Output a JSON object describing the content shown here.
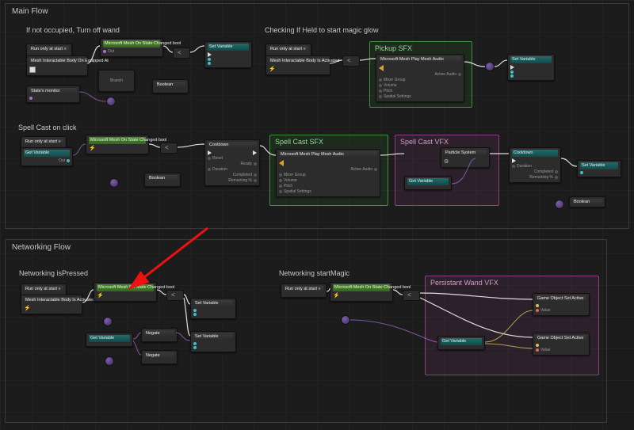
{
  "sections": {
    "main": {
      "label": "Main Flow"
    },
    "net": {
      "label": "Networking Flow"
    }
  },
  "comments": {
    "c1": "If not occupied, Turn off wand",
    "c2": "Checking If Held to start magic glow",
    "c3": "Spell Cast on click",
    "c4": "Networking isPressed",
    "c5": "Networking startMagic"
  },
  "groups": {
    "pickup_sfx": {
      "title": "Pickup SFX"
    },
    "cast_sfx": {
      "title": "Spell Cast SFX"
    },
    "cast_vfx": {
      "title": "Spell Cast VFX"
    },
    "persist_vfx": {
      "title": "Persistant Wand VFX"
    }
  },
  "node_labels": {
    "run_every": "Run only at start »",
    "on_state_change": "Microsoft Mesh\nOn State Changed\nbool",
    "on_equipped": "Mesh Interactable Body\nOn Equipped At",
    "state_monitor": "State's monitor",
    "set_variable": "Set Variable",
    "get_variable": "Get Variable",
    "branch": "Branch",
    "boolean": "Boolean",
    "play_audio": "Microsoft Mesh\nPlay Mesh Audio",
    "cooldown": "Cooldown",
    "particle_sys": "Particle System",
    "is_activated": "Mesh Interactable Body\nIs Activated",
    "negate": "Negate",
    "set_active": "Game Object\nSet Active",
    "pins": {
      "out": "Out",
      "value": "Value",
      "ready": "Ready",
      "completed": "Completed",
      "remaining": "Remaining %",
      "duration": "Duration",
      "mixer_group": "Mixer Group",
      "volume": "Volume",
      "pitch": "Pitch",
      "spatial": "Spatial Settings",
      "active_audio": "Active Audio"
    }
  }
}
